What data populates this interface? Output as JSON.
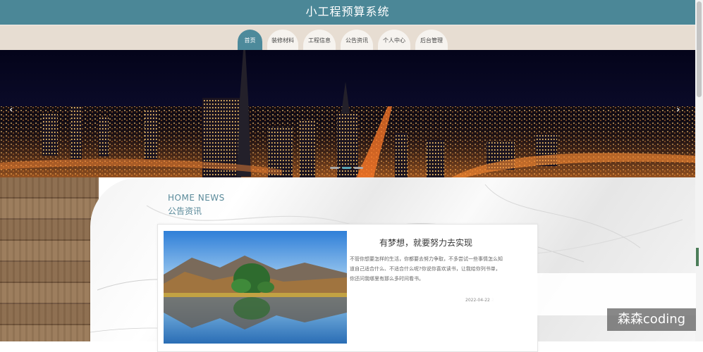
{
  "header": {
    "title": "小工程预算系统"
  },
  "nav": {
    "items": [
      "首页",
      "装修材料",
      "工程信息",
      "公告资讯",
      "个人中心",
      "后台管理"
    ],
    "active_index": 0
  },
  "banner": {
    "prev_arrow": "‹",
    "next_arrow": "›",
    "slide_count": 3,
    "active_slide": 1
  },
  "section": {
    "title_en": "HOME NEWS",
    "title_zh": "公告资讯"
  },
  "news": {
    "title": "有梦想，就要努力去实现",
    "body": "不管你想要怎样的生活，你都要去努力争取，不多尝试一些事情怎么知道自己适合什么、不适合什么呢?你说你喜欢读书，让我给你列书单，你还问我哪里有那么多时间看书。",
    "date": "2022-04-22 2"
  },
  "watermark": "森森coding",
  "colors": {
    "header": "#4b8797",
    "nav_active": "#4d8a9b",
    "nav_band": "#e7ddd2",
    "section_text": "#5a8a9a"
  }
}
